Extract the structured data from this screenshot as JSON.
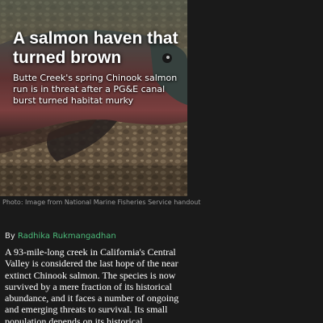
{
  "hero": {
    "image_description_icon": "salmon-photo",
    "title": "A salmon haven that turned brown",
    "dek": "Butte Creek's spring Chinook salmon run is in threat after a PG&E canal burst turned habitat murky"
  },
  "caption": "Photo: Image from National Marine Fisheries Service handout",
  "byline": {
    "prefix": "By",
    "author": "Radhika Rukmangadhan"
  },
  "article": {
    "body": "A 93-mile-long creek in California's Central Valley is considered the last hope of the near extinct Chinook salmon. The species is now survived by a mere fraction of its historical abundance, and it faces a number of ongoing and emerging threats to survival. Its small population depends on its historical"
  },
  "colors": {
    "background": "#1a1a1a",
    "link": "#4cbb7a",
    "caption": "#9a9a9a"
  }
}
